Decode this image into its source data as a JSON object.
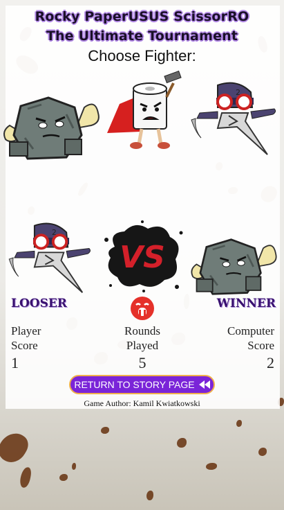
{
  "title": {
    "line1": "Rocky PaperUSUS ScissorRO",
    "line2": "The Ultimate Tournament",
    "subtitle": "Choose Fighter:"
  },
  "fighters": [
    {
      "name": "rock",
      "icon": "rock-fighter-icon"
    },
    {
      "name": "paper",
      "icon": "paper-fighter-icon"
    },
    {
      "name": "scissors",
      "icon": "scissors-fighter-icon"
    }
  ],
  "battle": {
    "player_choice_icon": "scissors-fighter-icon",
    "computer_choice_icon": "rock-fighter-icon",
    "vs_icon": "vs-splatter-icon",
    "player_status": "LOOSER",
    "computer_status": "WINNER",
    "result_icon": "crying-face-icon"
  },
  "scores": {
    "player_label_1": "Player",
    "player_label_2": "Score",
    "player_score": "1",
    "rounds_label_1": "Rounds",
    "rounds_label_2": "Played",
    "rounds_played": "5",
    "computer_label_1": "Computer",
    "computer_label_2": "Score",
    "computer_score": "2"
  },
  "footer": {
    "return_label": "RETURN TO STORY PAGE",
    "return_icon": "double-chevron-left-icon",
    "author": "Game Author: Kamil Kwiatkowski"
  },
  "colors": {
    "accent": "#7a24d8",
    "button_border": "#f0b04a",
    "status_text": "#3a1170",
    "result_icon": "#e5312a"
  }
}
